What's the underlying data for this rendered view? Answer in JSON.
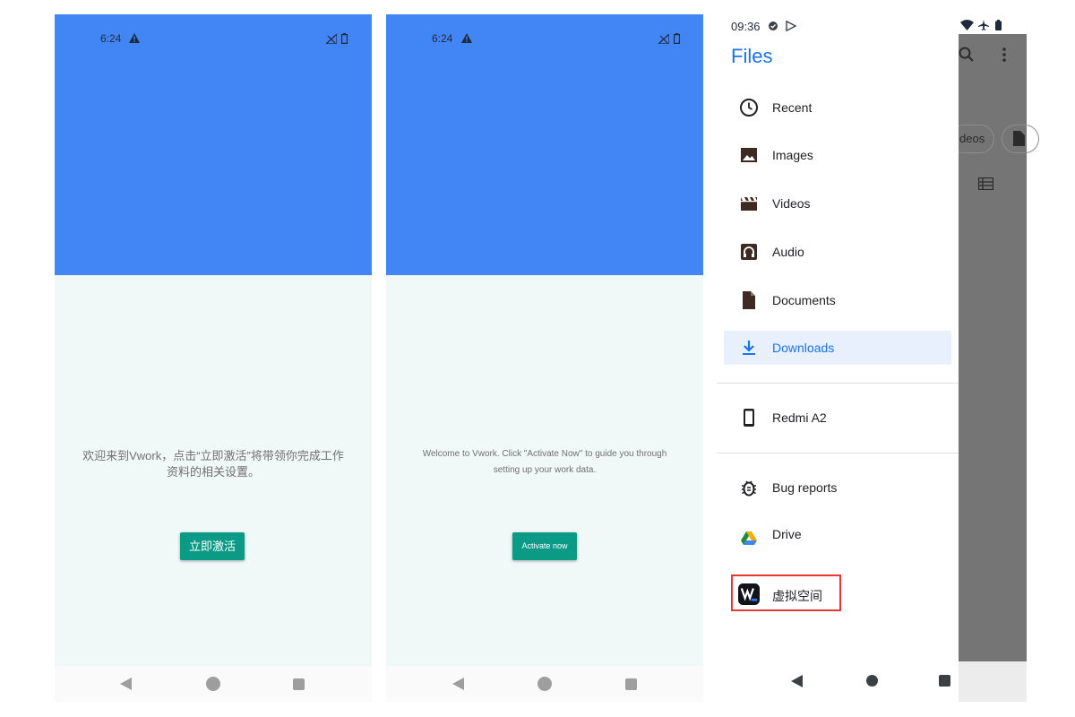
{
  "screen1": {
    "status_time": "6:24",
    "welcome_text": "欢迎来到Vwork，点击“立即激活”将带领你完成工作资料的相关设置。",
    "activate_label": "立即激活"
  },
  "screen2": {
    "status_time": "6:24",
    "welcome_text": "Welcome to Vwork. Click \"Activate Now\" to guide you through setting up your work data.",
    "activate_label": "Activate now"
  },
  "screen3": {
    "status_time": "09:36",
    "app_title": "Files",
    "drawer_items": [
      {
        "label": "Recent",
        "icon": "clock-icon"
      },
      {
        "label": "Images",
        "icon": "image-icon"
      },
      {
        "label": "Videos",
        "icon": "video-icon"
      },
      {
        "label": "Audio",
        "icon": "audio-icon"
      },
      {
        "label": "Documents",
        "icon": "document-icon"
      },
      {
        "label": "Downloads",
        "icon": "download-icon",
        "selected": true
      },
      {
        "label": "Redmi A2",
        "icon": "phone-icon"
      },
      {
        "label": "Bug reports",
        "icon": "bug-icon"
      },
      {
        "label": "Drive",
        "icon": "drive-icon"
      },
      {
        "label": "虚拟空间",
        "icon": "vwork-app-icon",
        "highlighted": true
      }
    ],
    "chip_partial_label": "deos",
    "highlight_color": "#e53935",
    "accent_color": "#1a73e8"
  },
  "colors": {
    "header_blue": "#4285f4",
    "button_teal": "#0a9a86",
    "content_bg": "#f0f9f7"
  }
}
